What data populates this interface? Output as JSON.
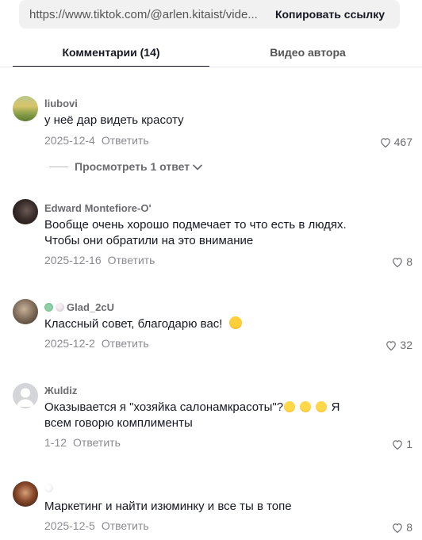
{
  "url_bar": {
    "url": "https://www.tiktok.com/@arlen.kitaist/vide...",
    "copy_label": "Копировать ссылку"
  },
  "tabs": [
    {
      "label": "Комментарии (14)",
      "active": true
    },
    {
      "label": "Видео автора",
      "active": false
    }
  ],
  "comments": [
    {
      "username": "liubovi",
      "text": "у неё дар видеть красоту",
      "date": "2025-12-4",
      "reply_label": "Ответить",
      "likes": "467",
      "view_replies": "Просмотреть 1 ответ"
    },
    {
      "username": "Edward Montefiore-O'",
      "text": "Вообще очень хорошо подмечает то что есть в людях. Чтобы они обратили на это внимание",
      "date": "2025-12-16",
      "reply_label": "Ответить",
      "likes": "8"
    },
    {
      "username": "Glad_2cU",
      "text": "Классный совет, благодарю вас!",
      "date": "2025-12-2",
      "reply_label": "Ответить",
      "likes": "32"
    },
    {
      "username": "Жuldiz",
      "text_before": "Оказывается я \"хозяйка салонамкрасоты\"?",
      "text_after": " Я всем говорю комплименты",
      "date": "1-12",
      "reply_label": "Ответить",
      "likes": "1"
    },
    {
      "username": "",
      "text": "Маркетинг и найти изюминку и все ты в топе",
      "date": "2025-12-5",
      "reply_label": "Ответить",
      "likes": "8"
    }
  ],
  "icons": {
    "heart": "heart-outline-icon",
    "chevron": "chevron-down-icon",
    "emoji_laugh": "rolling-laughing-emoji-icon",
    "emoji_hug": "hugging-face-emoji-icon"
  },
  "colors": {
    "text_primary": "#161823",
    "text_secondary": "#8a8b91",
    "username": "#6b6b70",
    "url_bar_bg": "#f1f1f2"
  }
}
